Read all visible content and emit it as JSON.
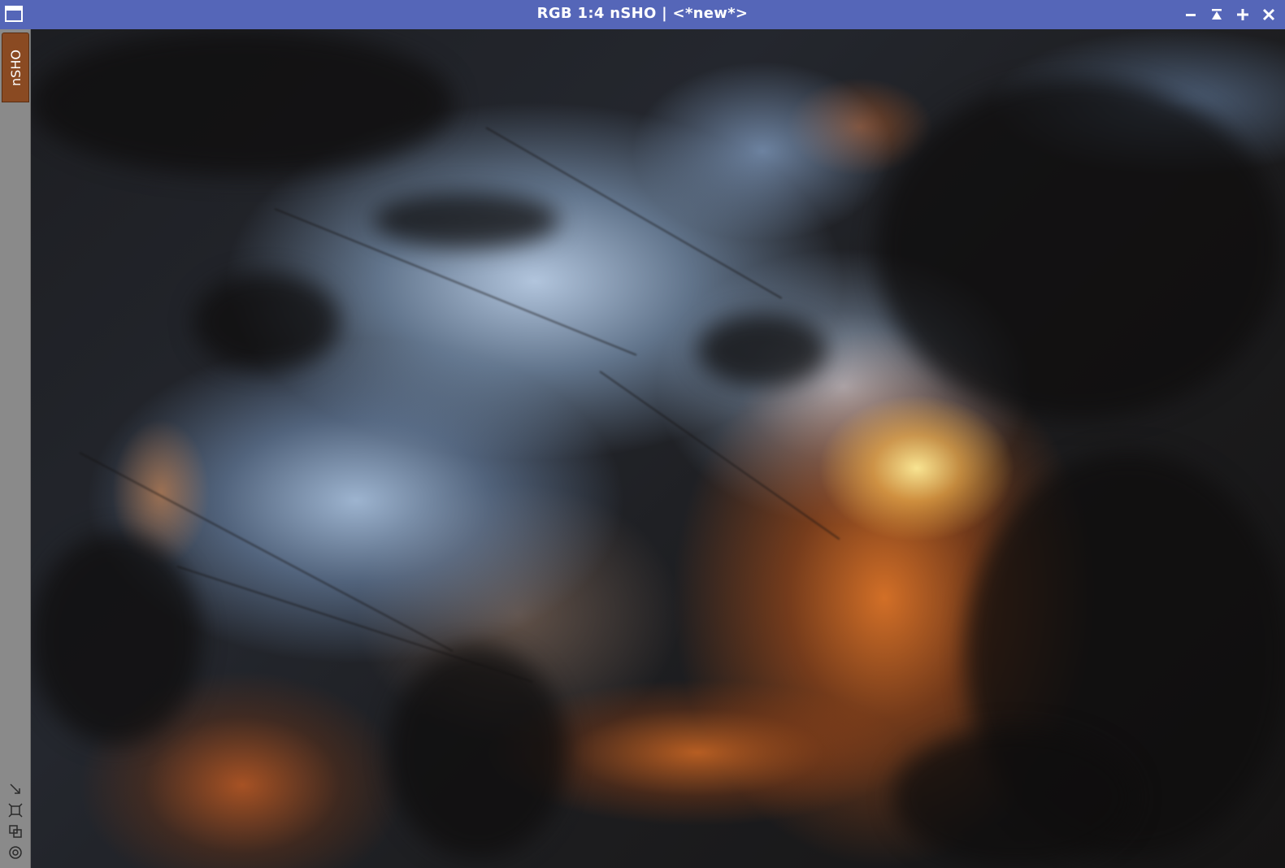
{
  "window": {
    "title": "RGB 1:4 nSHO | <*new*>",
    "titlebar_color": "#5566b8"
  },
  "titlebar": {
    "app_icon": "window-icon",
    "controls": [
      "minimize-icon",
      "shade-icon",
      "maximize-icon",
      "close-icon"
    ]
  },
  "sidebar": {
    "identifier": "nSHO",
    "identifier_tab_color": "#8a4a22",
    "tools": [
      "fit-to-window-icon",
      "zoom-to-fit-icon",
      "clone-icon",
      "stf-icon"
    ]
  },
  "image": {
    "description_colors": {
      "highlight": "#ffe896",
      "orange": "#e07828",
      "blue": "#b9cde6",
      "dark": "#1a1a1a"
    }
  }
}
